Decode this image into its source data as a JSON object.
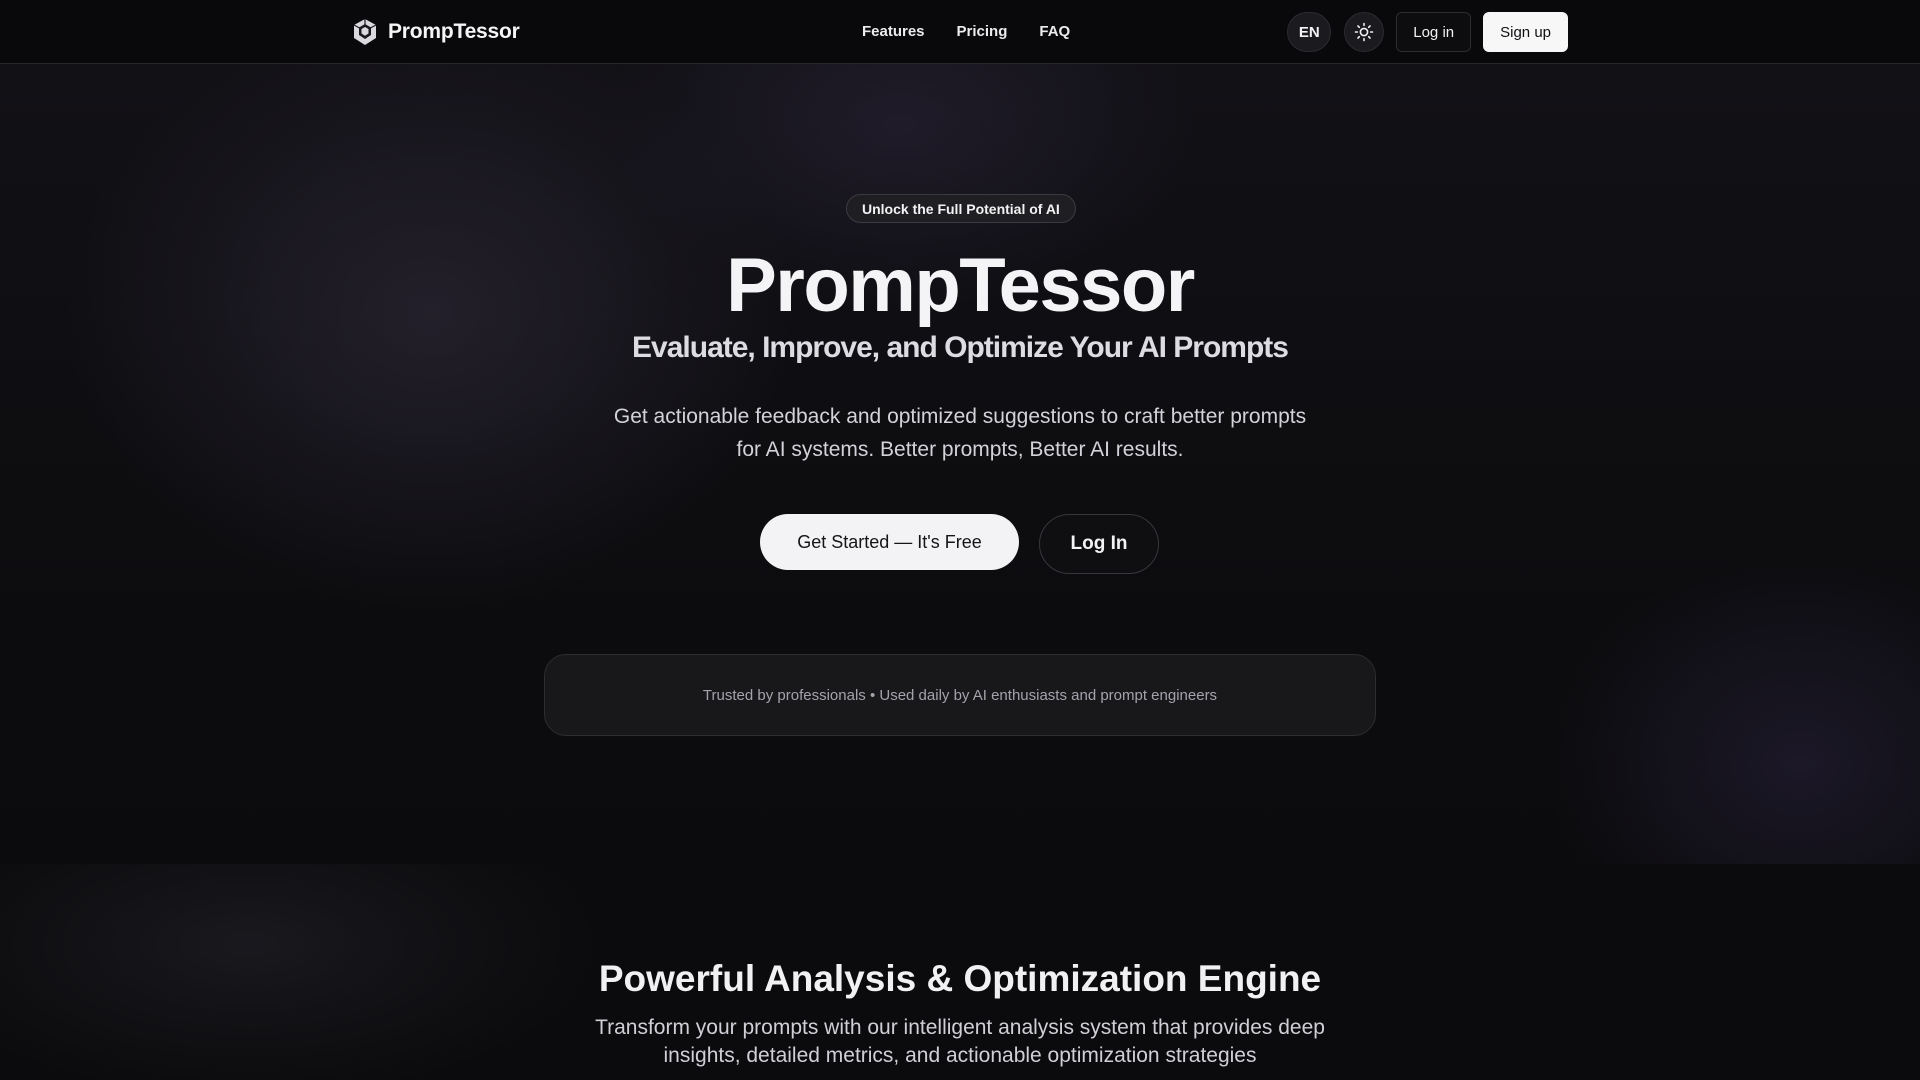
{
  "brand": {
    "name": "PrompTessor",
    "logo_icon": "shield-hexagon-logo-icon"
  },
  "nav": {
    "links": [
      {
        "label": "Features"
      },
      {
        "label": "Pricing"
      },
      {
        "label": "FAQ"
      }
    ],
    "language": "EN",
    "theme_icon": "sun-icon",
    "login_label": "Log in",
    "signup_label": "Sign up"
  },
  "hero": {
    "badge": "Unlock the Full Potential of AI",
    "title": "PrompTessor",
    "subtitle": "Evaluate, Improve, and Optimize Your AI Prompts",
    "description": "Get actionable feedback and optimized suggestions to craft better prompts for AI systems. Better prompts, Better AI results.",
    "cta_primary": "Get Started — It's Free",
    "cta_secondary": "Log In",
    "trust_text": "Trusted by professionals • Used daily by AI enthusiasts and prompt engineers"
  },
  "features": {
    "title": "Powerful Analysis & Optimization Engine",
    "description": "Transform your prompts with our intelligent analysis system that provides deep insights, detailed metrics, and actionable optimization strategies"
  },
  "colors": {
    "background": "#0b0b0d",
    "primary_button": "#f3f3f5",
    "text": "#f2f2f3",
    "muted_text": "#a3a3ab"
  }
}
